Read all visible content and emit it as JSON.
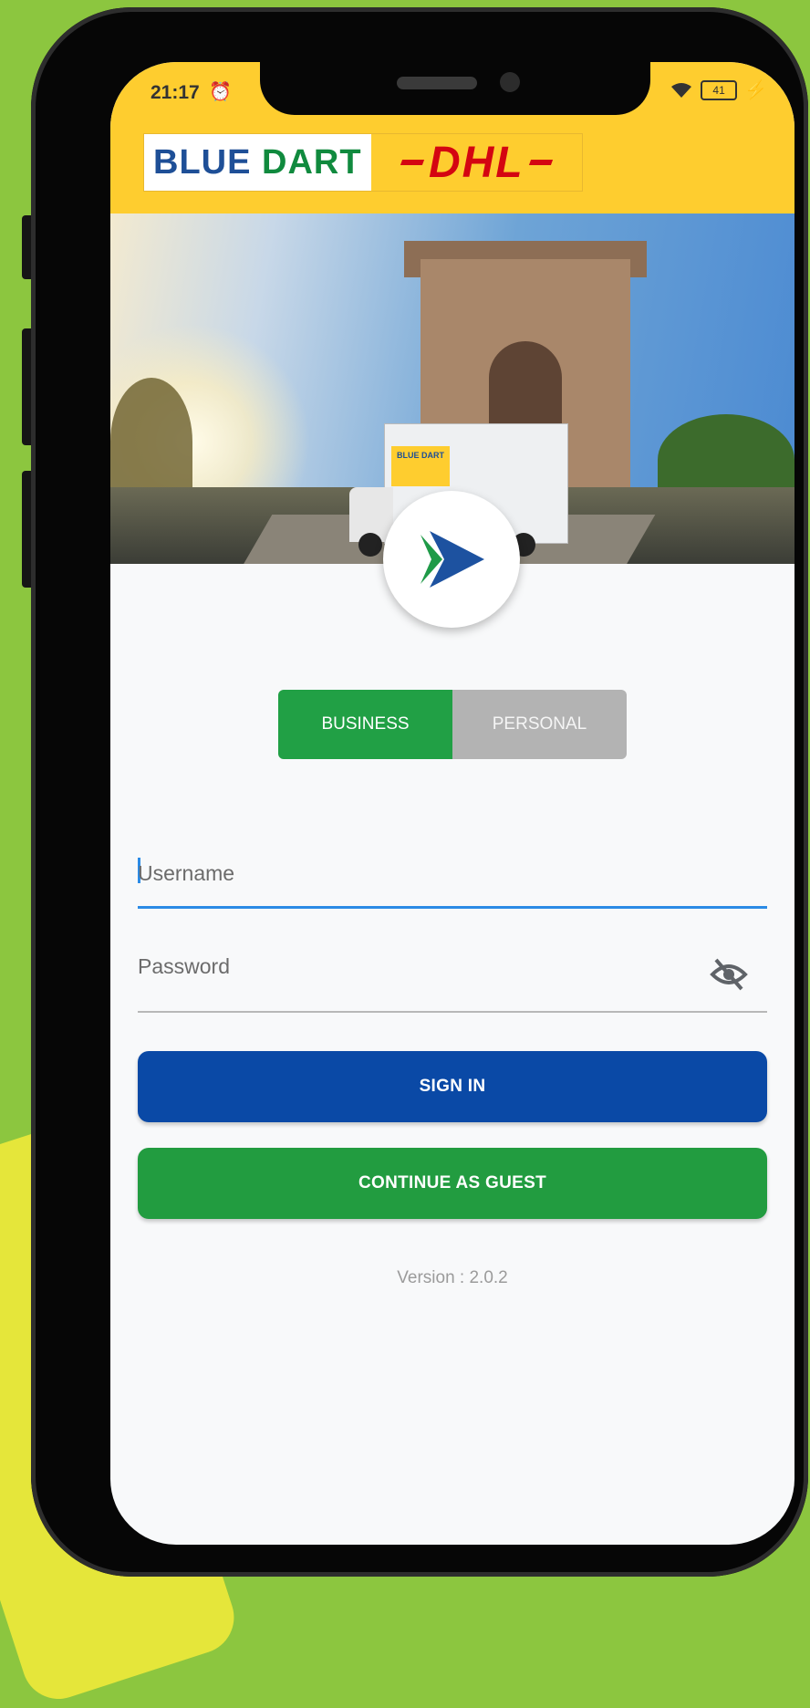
{
  "status_bar": {
    "time": "21:17",
    "alarm_icon": "alarm-icon",
    "wifi_icon": "wifi-icon",
    "battery_level": "41"
  },
  "header": {
    "logo_blue": "BLUE",
    "logo_dart": "DART",
    "logo_dhl": "DHL",
    "brand_colors": {
      "yellow": "#fecd2f",
      "blue": "#1e4f97",
      "green": "#108a3e",
      "red": "#d40511"
    }
  },
  "hero": {
    "truck_sign": "BLUE DART"
  },
  "toggle": {
    "business_label": "BUSINESS",
    "personal_label": "PERSONAL",
    "selected": "BUSINESS"
  },
  "form": {
    "username_placeholder": "Username",
    "password_placeholder": "Password",
    "password_toggle_icon": "eye-off-icon"
  },
  "actions": {
    "sign_in_label": "SIGN IN",
    "guest_label": "CONTINUE AS GUEST"
  },
  "footer": {
    "version": "Version : 2.0.2"
  },
  "colors": {
    "primary_blue": "#0a49a6",
    "primary_green": "#229c40",
    "accent_line": "#2b8be6"
  }
}
